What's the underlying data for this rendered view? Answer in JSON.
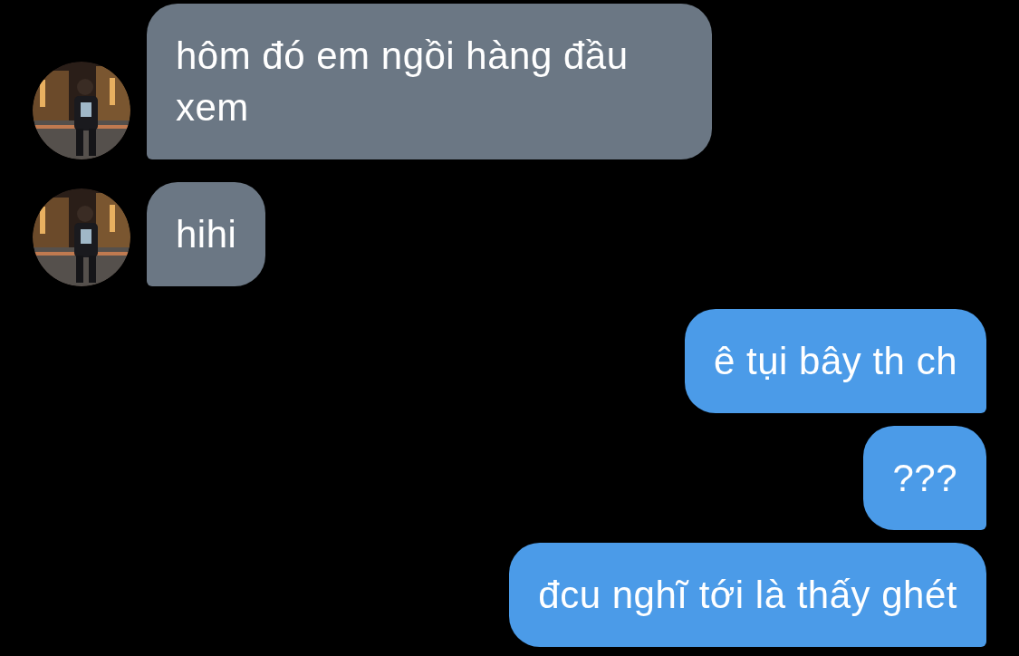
{
  "messages": [
    {
      "kind": "incoming",
      "text": "hôm đó em ngồi hàng đầu xem"
    },
    {
      "kind": "incoming",
      "text": "hihi"
    },
    {
      "kind": "outgoing",
      "text": "ê tụi bây th ch"
    },
    {
      "kind": "outgoing",
      "text": "???"
    },
    {
      "kind": "outgoing",
      "text": "đcu nghĩ tới là thấy ghét"
    }
  ]
}
